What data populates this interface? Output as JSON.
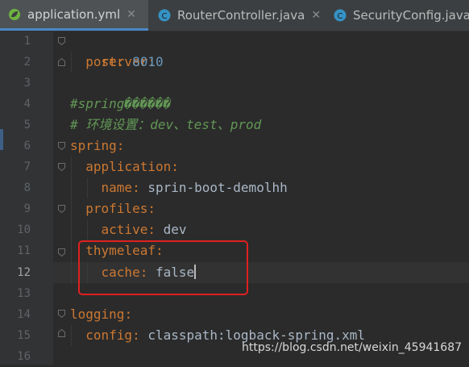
{
  "tabs": [
    {
      "label": "application.yml",
      "icon": "spring-leaf-icon",
      "active": true
    },
    {
      "label": "RouterController.java",
      "icon": "class-c-icon",
      "active": false
    },
    {
      "label": "SecurityConfig.java",
      "icon": "class-c-icon",
      "active": false
    }
  ],
  "close_glyph": "✕",
  "lines": [
    {
      "n": "1",
      "key": "server",
      "punct": ":",
      "value": "",
      "value_type": "",
      "comment": ""
    },
    {
      "n": "2",
      "key": "port",
      "punct": ": ",
      "value": "8010",
      "value_type": "num",
      "comment": ""
    },
    {
      "n": "3",
      "key": "",
      "punct": "",
      "value": "",
      "value_type": "",
      "comment": ""
    },
    {
      "n": "4",
      "key": "",
      "punct": "",
      "value": "",
      "value_type": "",
      "comment": "#spring������"
    },
    {
      "n": "5",
      "key": "",
      "punct": "",
      "value": "",
      "value_type": "",
      "comment": "# 环境设置：dev、test、prod"
    },
    {
      "n": "6",
      "key": "spring",
      "punct": ":",
      "value": "",
      "value_type": "",
      "comment": ""
    },
    {
      "n": "7",
      "key": "application",
      "punct": ":",
      "value": "",
      "value_type": "",
      "comment": ""
    },
    {
      "n": "8",
      "key": "name",
      "punct": ": ",
      "value": "sprin-boot-demolhh",
      "value_type": "val",
      "comment": ""
    },
    {
      "n": "9",
      "key": "profiles",
      "punct": ":",
      "value": "",
      "value_type": "",
      "comment": ""
    },
    {
      "n": "10",
      "key": "active",
      "punct": ": ",
      "value": "dev",
      "value_type": "val",
      "comment": ""
    },
    {
      "n": "11",
      "key": "thymeleaf",
      "punct": ":",
      "value": "",
      "value_type": "",
      "comment": ""
    },
    {
      "n": "12",
      "key": "cache",
      "punct": ": ",
      "value": "false",
      "value_type": "val",
      "comment": ""
    },
    {
      "n": "13",
      "key": "",
      "punct": "",
      "value": "",
      "value_type": "",
      "comment": ""
    },
    {
      "n": "14",
      "key": "logging",
      "punct": ":",
      "value": "",
      "value_type": "",
      "comment": ""
    },
    {
      "n": "15",
      "key": "config",
      "punct": ": ",
      "value": "classpath:logback-spring.xml",
      "value_type": "val",
      "comment": ""
    },
    {
      "n": "16",
      "key": "",
      "punct": "",
      "value": "",
      "value_type": "",
      "comment": ""
    }
  ],
  "current_line": "12",
  "watermark": "https://blog.csdn.net/weixin_45941687",
  "colors": {
    "key": "#cc7832",
    "number": "#6897bb",
    "comment": "#629755",
    "highlight_box": "#e02020"
  }
}
